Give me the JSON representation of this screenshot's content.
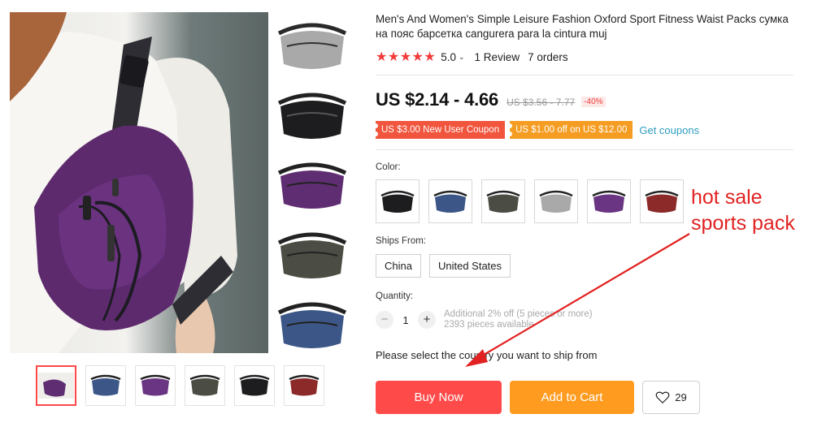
{
  "product": {
    "title": "Men's And Women's Simple Leisure Fashion Oxford Sport Fitness Waist Packs сумка на пояс барсетка cangurera para la cintura muj",
    "stars": "★★★★★",
    "rating": "5.0",
    "reviews": "1 Review",
    "orders": "7 orders",
    "rating_value": 5.0
  },
  "price": {
    "current": "US $2.14 - 4.66",
    "original": "US $3.56 - 7.77",
    "discount": "-40%"
  },
  "coupons": [
    {
      "label": "US $3.00 New User Coupon"
    },
    {
      "label": "US $1.00 off on US $12.00"
    }
  ],
  "get_coupons_label": "Get coupons",
  "color": {
    "label": "Color:",
    "options": [
      "black",
      "blue",
      "green",
      "gray",
      "purple",
      "red"
    ]
  },
  "ships_from": {
    "label": "Ships From:",
    "options": [
      "China",
      "United States"
    ]
  },
  "quantity": {
    "label": "Quantity:",
    "minus": "−",
    "value": "1",
    "plus": "+",
    "note_line1": "Additional 2% off (5 pieces or more)",
    "note_line2": "2393 pieces available"
  },
  "ship_message": "Please select the country you want to ship from",
  "actions": {
    "buy_now": "Buy Now",
    "add_to_cart": "Add to Cart",
    "wishlist_count": "29"
  },
  "annotation": {
    "line1": "hot sale",
    "line2": "sports pack"
  },
  "gallery": {
    "side_thumbs": [
      "gray",
      "black",
      "purple",
      "green",
      "blue"
    ],
    "bottom_thumbs": [
      "purple",
      "blue",
      "purple",
      "green",
      "black",
      "red"
    ],
    "active_index": 0
  },
  "colors": {
    "accent_red": "#ff4a4a",
    "accent_orange": "#ff9c20",
    "star_red": "#f23b3b",
    "link_blue": "#2e9cc0",
    "annotation_red": "#e22222"
  }
}
